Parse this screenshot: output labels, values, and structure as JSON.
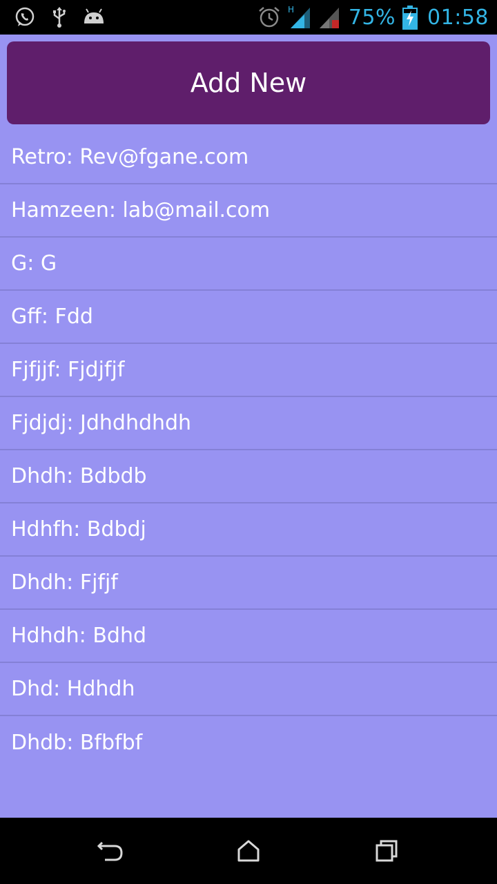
{
  "status_bar": {
    "left_icons": [
      "whatsapp-icon",
      "usb-icon",
      "android-debug-icon"
    ],
    "right_icons": [
      "alarm-icon",
      "signal-h-icon",
      "signal-roaming-icon",
      "battery-charging-icon"
    ],
    "network_type": "H",
    "battery_percent": "75%",
    "time": "01:58",
    "accent_color": "#33b5e5"
  },
  "add_button": {
    "label": "Add New",
    "color": "#5f1e6b"
  },
  "contacts": [
    {
      "text": "Retro: Rev@fgane.com"
    },
    {
      "text": "Hamzeen: lab@mail.com"
    },
    {
      "text": "G: G"
    },
    {
      "text": "Gff: Fdd"
    },
    {
      "text": "Fjfjjf: Fjdjfjf"
    },
    {
      "text": "Fjdjdj: Jdhdhdhdh"
    },
    {
      "text": "Dhdh: Bdbdb"
    },
    {
      "text": "Hdhfh: Bdbdj"
    },
    {
      "text": "Dhdh: Fjfjf"
    },
    {
      "text": "Hdhdh: Bdhd"
    },
    {
      "text": "Dhd: Hdhdh"
    },
    {
      "text": "Dhdb: Bfbfbf"
    }
  ],
  "background_color": "#9893f2",
  "nav_bar": {
    "icons": [
      "back-icon",
      "home-icon",
      "recent-apps-icon"
    ]
  }
}
